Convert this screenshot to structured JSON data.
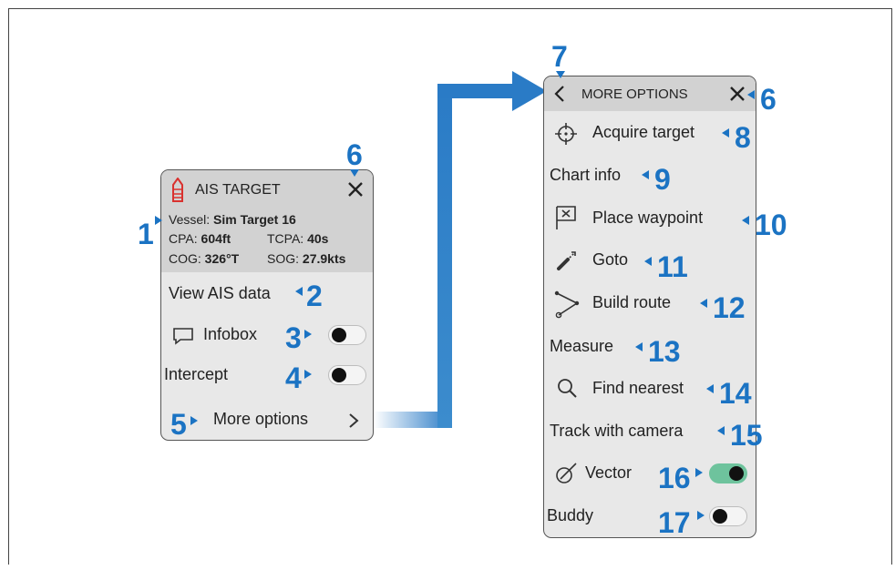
{
  "ais_panel": {
    "title": "AIS TARGET",
    "vessel_label": "Vessel:",
    "vessel_value": "Sim Target 16",
    "cpa_label": "CPA:",
    "cpa_value": "604ft",
    "tcpa_label": "TCPA:",
    "tcpa_value": "40s",
    "cog_label": "COG:",
    "cog_value": "326°T",
    "sog_label": "SOG:",
    "sog_value": "27.9kts",
    "view_ais_data": "View AIS data",
    "infobox": "Infobox",
    "infobox_on": false,
    "intercept": "Intercept",
    "intercept_on": false,
    "more_options": "More options"
  },
  "more_panel": {
    "title": "MORE OPTIONS",
    "items": {
      "acquire_target": "Acquire target",
      "chart_info": "Chart info",
      "place_waypoint": "Place waypoint",
      "goto": "Goto",
      "build_route": "Build route",
      "measure": "Measure",
      "find_nearest": "Find nearest",
      "track_with_camera": "Track with camera",
      "vector": "Vector",
      "buddy": "Buddy"
    },
    "vector_on": true,
    "buddy_on": false
  },
  "callouts": {
    "c1": "1",
    "c2": "2",
    "c3": "3",
    "c4": "4",
    "c5": "5",
    "c6a": "6",
    "c6b": "6",
    "c7": "7",
    "c8": "8",
    "c9": "9",
    "c10": "10",
    "c11": "11",
    "c12": "12",
    "c13": "13",
    "c14": "14",
    "c15": "15",
    "c16": "16",
    "c17": "17"
  },
  "colors": {
    "callout_blue": "#1b73c3",
    "toggle_on_green": "#6ec39d",
    "header_gray": "#d2d2d2",
    "panel_gray": "#e8e8e8"
  },
  "icons": [
    "ais-vessel-icon",
    "close-icon",
    "back-chevron-icon",
    "crosshair-icon",
    "waypoint-flag-icon",
    "goto-icon",
    "route-icon",
    "search-icon",
    "vector-icon",
    "infobox-icon",
    "chevron-right-icon"
  ]
}
